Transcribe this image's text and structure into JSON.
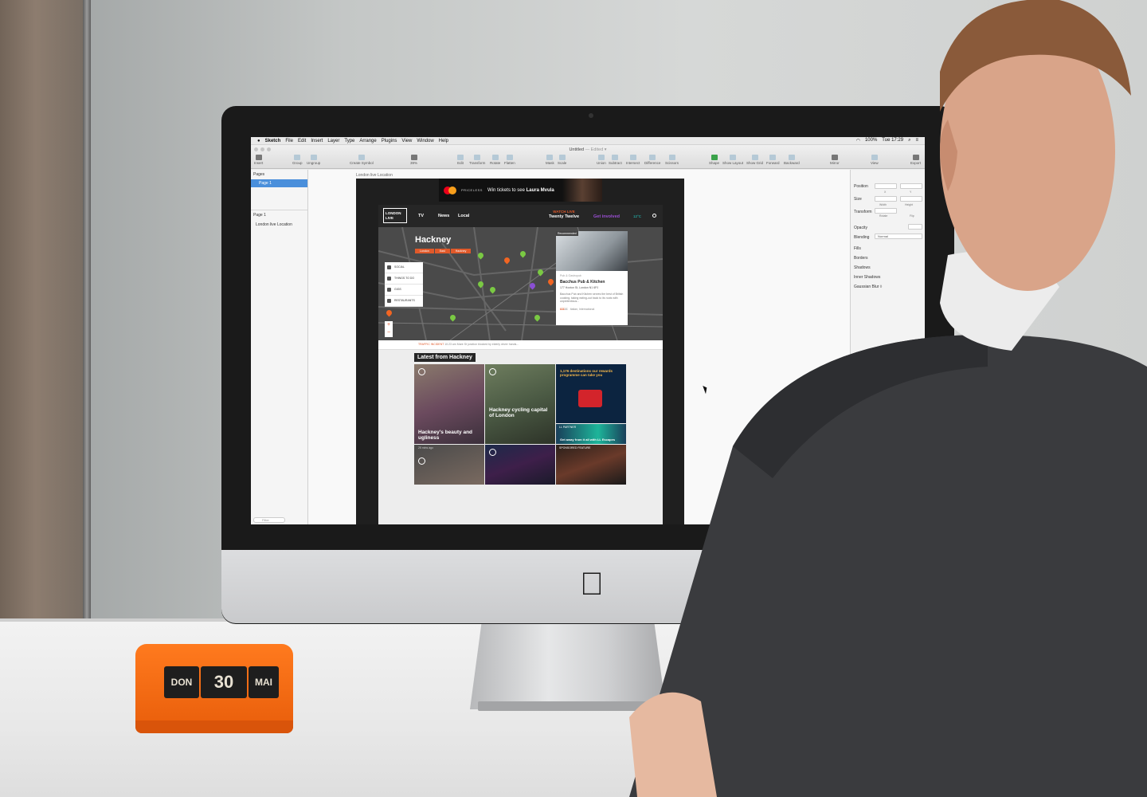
{
  "sketch": {
    "menubar": {
      "app": "Sketch",
      "items": [
        "File",
        "Edit",
        "Insert",
        "Layer",
        "Type",
        "Arrange",
        "Plugins",
        "View",
        "Window",
        "Help"
      ],
      "battery": "100%",
      "clock": "Tue 17:29"
    },
    "doc_title": "Untitled",
    "doc_state": "— Edited ▾",
    "toolbar": {
      "insert": "Insert",
      "group": "Group",
      "ungroup": "Ungroup",
      "create_symbol": "Create Symbol",
      "zoom": "39%",
      "edit": "Edit",
      "transform": "Transform",
      "rotate": "Rotate",
      "flatten": "Flatten",
      "mask": "Mask",
      "scale": "Scale",
      "union": "Union",
      "subtract": "Subtract",
      "intersect": "Intersect",
      "difference": "Difference",
      "scissors": "Scissors",
      "shape": "Shape",
      "show_layout": "Show Layout",
      "show_grid": "Show Grid",
      "forward": "Forward",
      "backward": "Backward",
      "mirror": "Mirror",
      "view": "View",
      "export": "Export"
    },
    "left_panel": {
      "pages_label": "Pages",
      "page": "Page 1",
      "layers_header": "Page 1",
      "layer": "London live Location",
      "filter_placeholder": "Filter"
    },
    "artboard_label": "London live Location",
    "right_panel": {
      "position": "Position",
      "x": "X",
      "y": "Y",
      "size": "Size",
      "width": "Width",
      "height": "Height",
      "transform": "Transform",
      "rotate": "Rotate",
      "flip": "Flip",
      "opacity": "Opacity",
      "blending": "Blending",
      "blending_value": "Normal",
      "fills": "Fills",
      "borders": "Borders",
      "shadows": "Shadows",
      "inner_shadows": "Inner Shadows",
      "gaussian_blur": "Gaussian Blur ◊"
    }
  },
  "site": {
    "ad": {
      "brand": "PRICELESS",
      "brand_city": "LONDON",
      "text_pre": "Win tickets to see",
      "text_name": "Laura Mvula"
    },
    "logo": "LONDON LIVE",
    "nav": [
      "TV",
      "News",
      "Local"
    ],
    "watch_live": "WATCH LIVE",
    "now_showing": "Twenty Twelve",
    "get_involved": "Get involved",
    "temperature": "12°C",
    "map": {
      "title": "Hackney",
      "tags": [
        "London",
        "East",
        "Hackney"
      ],
      "filters": [
        "SOCIAL",
        "THINGS TO DO",
        "GIGS",
        "RESTAURANTS"
      ],
      "zoom_in": "+",
      "zoom_out": "−"
    },
    "recommended": {
      "tag": "Recommended",
      "type": "Pub & Gastropub",
      "name": "Bacchus Pub & Kitchen",
      "address": "177 Hoxton St, London N1 6PJ",
      "desc": "Bacchus Pub and Kitchen serves the best of British cooking, taking eating-out back to its roots with unpretentious...",
      "price": "£££",
      "price_rest": "££",
      "cuisine": "Italian, International"
    },
    "traffic": {
      "label": "TRAFFIC INCIDENT",
      "time": "10:23 am",
      "text": "Mare St junction blocked by elderly driver hands..."
    },
    "latest_title": "Latest from Hackney",
    "tiles": [
      {
        "caption": "Hackney's beauty and ugliness"
      },
      {
        "caption": "Hackney cycling capital of London"
      },
      {
        "caption": "1,176 destinations our rewards programme can take you"
      },
      {
        "caption": "Get away from it all with LL Escapes",
        "tag": "LL PARTNER"
      },
      {
        "caption": "",
        "meta": "25 mins ago"
      },
      {
        "caption": ""
      },
      {
        "caption": "",
        "tag": "SPONSORED FEATURE"
      }
    ]
  },
  "calendar": {
    "day": "DON",
    "date": "30",
    "month": "MAI"
  }
}
